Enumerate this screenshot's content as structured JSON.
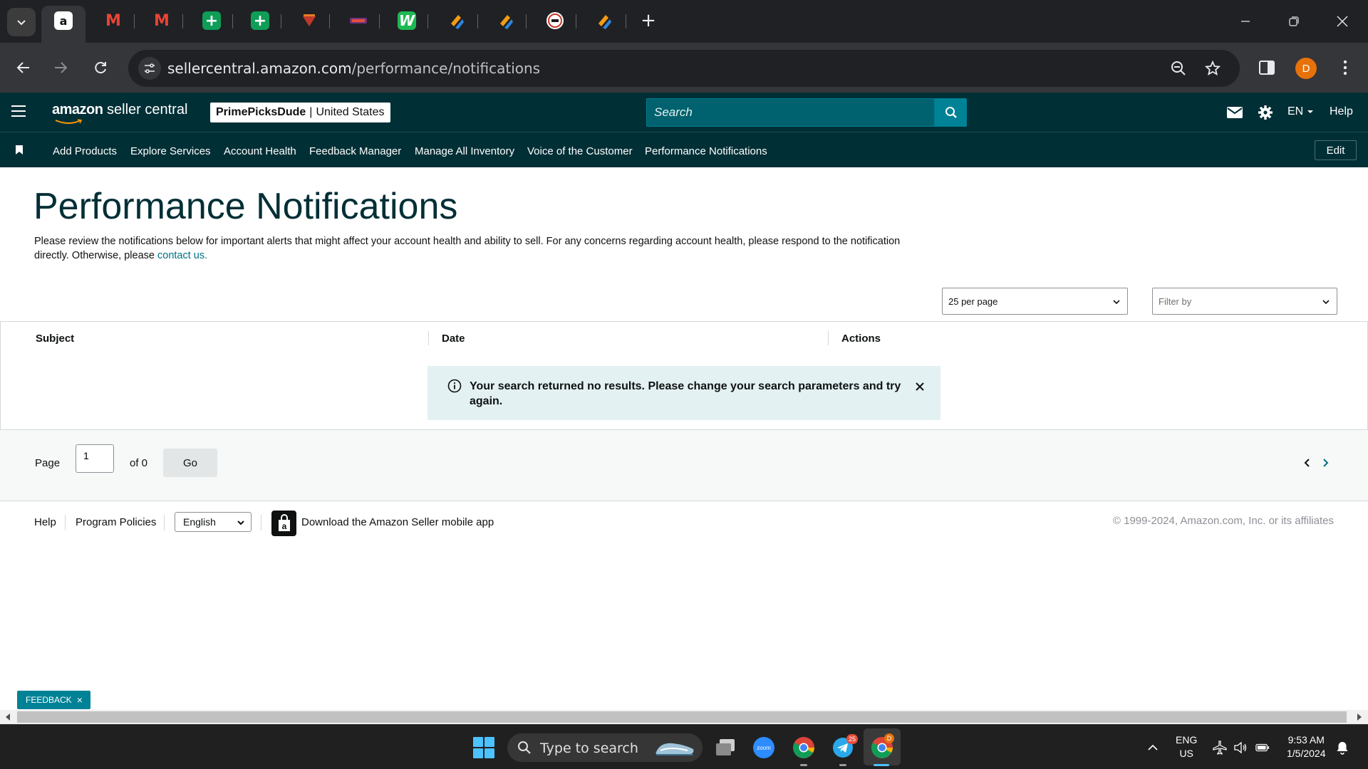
{
  "browser": {
    "tabs": [
      {
        "icon": "amazon-icon",
        "active": true
      },
      {
        "icon": "gmail-icon"
      },
      {
        "icon": "gmail-icon"
      },
      {
        "icon": "google-sheets-icon"
      },
      {
        "icon": "google-sheets-icon"
      },
      {
        "icon": "site-favicon-icon"
      },
      {
        "icon": "site-favicon-icon"
      },
      {
        "icon": "w-app-icon"
      },
      {
        "icon": "task-app-icon"
      },
      {
        "icon": "task-app-icon"
      },
      {
        "icon": "circle-logo-icon"
      },
      {
        "icon": "task-app-icon"
      }
    ],
    "url_host": "sellercentral.amazon.com",
    "url_path": "/performance/notifications",
    "profile_initial": "D"
  },
  "header": {
    "logo_brand": "amazon",
    "logo_product": "seller central",
    "store_name": "PrimePicksDude",
    "marketplace": "United States",
    "search_placeholder": "Search",
    "language": "EN",
    "help_label": "Help"
  },
  "bookmarks": {
    "items": [
      "Add Products",
      "Explore Services",
      "Account Health",
      "Feedback Manager",
      "Manage All Inventory",
      "Voice of the Customer",
      "Performance Notifications"
    ],
    "edit_label": "Edit"
  },
  "main": {
    "title": "Performance Notifications",
    "intro_text": "Please review the notifications below for important alerts that might affect your account health and ability to sell. For any concerns regarding account health, please respond to the notification directly. Otherwise, please ",
    "intro_link": "contact us.",
    "per_page": "25 per page",
    "filter_placeholder": "Filter by",
    "columns": [
      "Subject",
      "Date",
      "Actions"
    ],
    "empty_message": "Your search returned no results. Please change your search parameters and try again."
  },
  "pager": {
    "page_label": "Page",
    "page_value": "1",
    "of_label": "of 0",
    "go_label": "Go"
  },
  "footer": {
    "help": "Help",
    "program_policies": "Program Policies",
    "language": "English",
    "app_link": "Download the Amazon Seller mobile app",
    "copyright": "© 1999-2024, Amazon.com, Inc. or its affiliates"
  },
  "feedback_label": "FEEDBACK",
  "taskbar": {
    "search_label": "Type to search",
    "telegram_badge": "25",
    "chrome_badge": "D",
    "lang_top": "ENG",
    "lang_bottom": "US",
    "time": "9:53 AM",
    "date": "1/5/2024"
  },
  "colors": {
    "header_bg": "#002f36",
    "accent_teal": "#008296",
    "link": "#007185",
    "alert_bg": "#e3f1f3"
  }
}
